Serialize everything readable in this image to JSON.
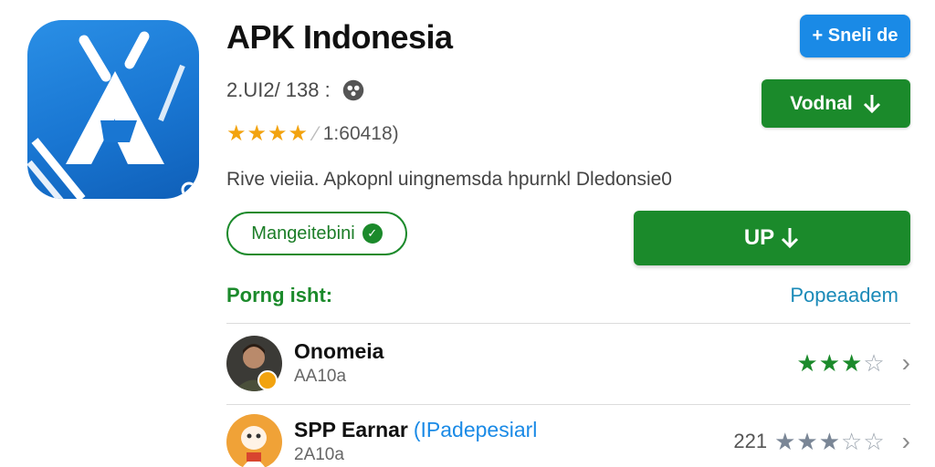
{
  "app": {
    "title": "APK Indonesia",
    "meta": "2.UI2/ 138 :",
    "rating_text": "1:60418)",
    "stars_filled": 4,
    "description": "Rive vieiia. Apkopnl uingnemsda hpurnkl Dledonsie0",
    "badge_label": "Mangeitebini"
  },
  "buttons": {
    "share_label": "+ Sneli de",
    "download_label": "Vodnal",
    "update_label": "UP"
  },
  "section": {
    "title": "Porng isht:",
    "link": "Popeaadem"
  },
  "reviews": [
    {
      "name": "Onomeia",
      "tag": "",
      "sub": "AA10a",
      "count": "",
      "stars": 3,
      "star_color": "#1b8a2b"
    },
    {
      "name": "SPP Earnar",
      "tag": "(IPadepesiarl",
      "sub": "2A10a",
      "count": "221",
      "stars": 3,
      "star_color": "#7a8696"
    }
  ],
  "colors": {
    "brand_blue": "#1a8ae6",
    "brand_green": "#1b8a2b",
    "star_gold": "#f2a30f"
  },
  "icons": [
    "app-logo-icon",
    "gear-icon",
    "check-icon",
    "download-arrow-icon",
    "chevron-right-icon"
  ]
}
